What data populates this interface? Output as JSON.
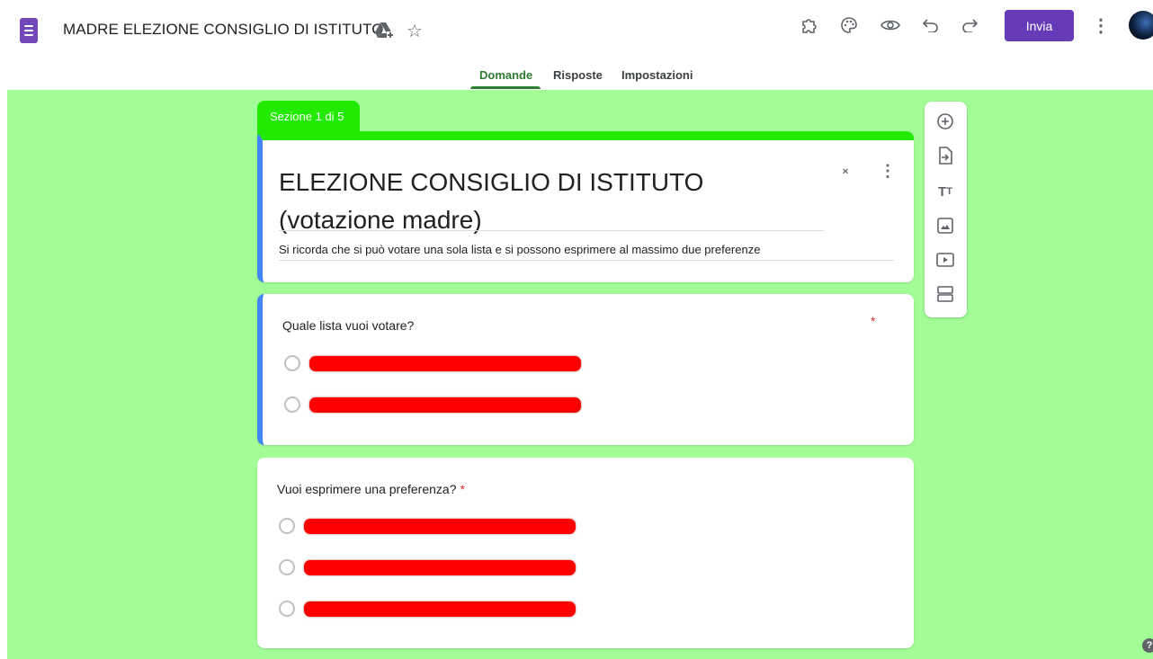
{
  "header": {
    "app_icon": "google-forms-icon",
    "title": "MADRE ELEZIONE CONSIGLIO DI ISTITUTO",
    "icons": [
      "move-to-drive-icon",
      "star-icon",
      "addon-puzzle-icon",
      "palette-icon",
      "preview-eye-icon",
      "undo-icon",
      "redo-icon",
      "more-vert-icon"
    ],
    "send_label": "Invia",
    "accent_color": "#673ab7"
  },
  "tabs": [
    {
      "label": "Domande",
      "active": true
    },
    {
      "label": "Risposte",
      "active": false
    },
    {
      "label": "Impostazioni",
      "active": false
    }
  ],
  "theme": {
    "background_color": "#a3fd97",
    "section_color": "#22ea02"
  },
  "section": {
    "label": "Sezione 1 di 5"
  },
  "form": {
    "title": "ELEZIONE CONSIGLIO DI ISTITUTO (votazione madre)",
    "description": "Si ricorda che si può votare una sola lista e si possono esprimere al massimo due preferenze"
  },
  "questions": [
    {
      "text": "Quale lista vuoi votare?",
      "required_mark": "*",
      "options_count": 2
    },
    {
      "text": "Vuoi esprimere una preferenza?",
      "required_mark": "*",
      "options_count": 3
    }
  ],
  "side_toolbar": {
    "icons": [
      "add-question-icon",
      "import-questions-icon",
      "add-title-icon",
      "add-image-icon",
      "add-video-icon",
      "add-section-icon"
    ]
  },
  "help_label": "?"
}
